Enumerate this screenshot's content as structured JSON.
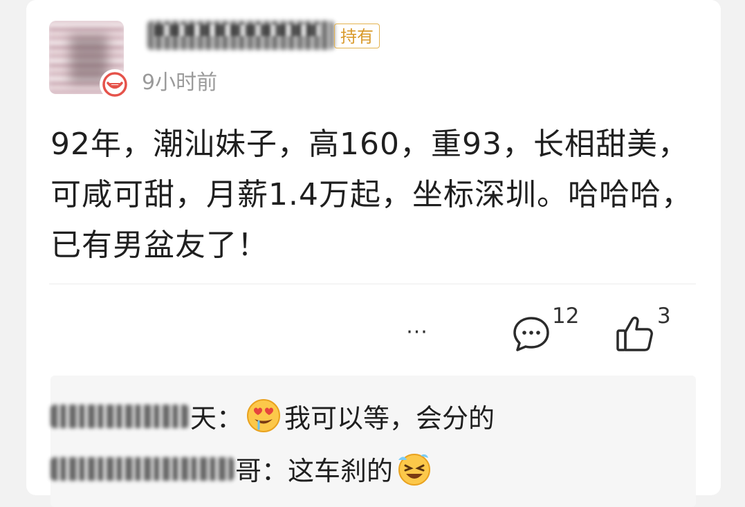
{
  "post": {
    "holding_badge": "持有",
    "time": "9小时前",
    "content": "92年，潮汕妹子，高160，重93，长相甜美，可咸可甜，月薪1.4万起，坐标深圳。哈哈哈，已有男盆友了！",
    "more_label": "···",
    "comment_count": "12",
    "like_count": "3"
  },
  "comments": [
    {
      "name_visible_suffix": "天",
      "separator": "：",
      "emoji": "drooling-heart-eyes-emoji",
      "text": "我可以等，会分的"
    },
    {
      "name_visible_suffix": "哥",
      "separator": "：",
      "text": "这车刹的",
      "emoji": "laughing-crying-emoji"
    }
  ],
  "colors": {
    "badge": "#d99a2b",
    "time": "#9a9a9a",
    "text": "#1f1f1f",
    "verified": "#e5534b"
  }
}
